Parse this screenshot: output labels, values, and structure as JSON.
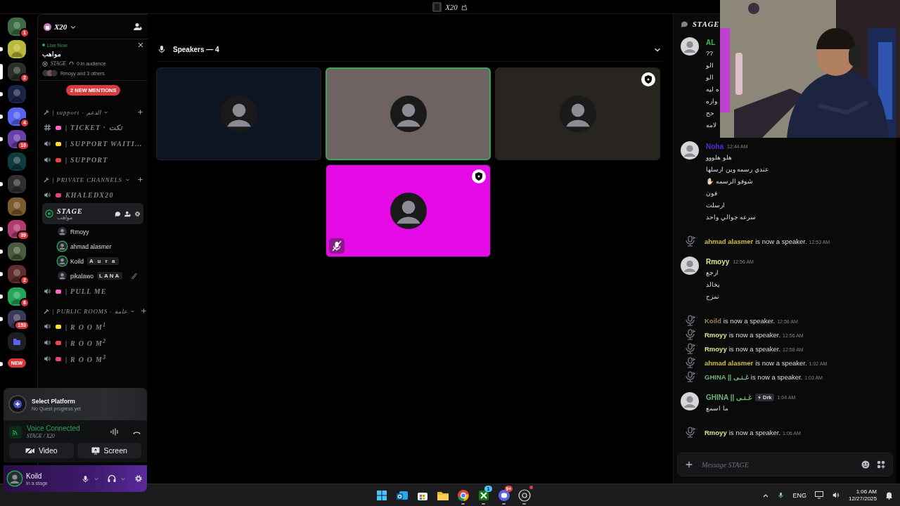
{
  "title_bar": {
    "title": "X20"
  },
  "servers": [
    {
      "kind": "server",
      "color": "#3e6b45",
      "badge": "1",
      "unread": false,
      "selected": false
    },
    {
      "kind": "server",
      "color": "#b9b838",
      "unread": true,
      "selected": false
    },
    {
      "kind": "server",
      "color": "#2b302c",
      "badge": "2",
      "unread": false,
      "selected": true
    },
    {
      "kind": "server",
      "color": "#1b2446",
      "unread": true,
      "selected": false
    },
    {
      "kind": "server",
      "color": "#5865f2",
      "badge": "4",
      "unread": true,
      "selected": false
    },
    {
      "kind": "server",
      "color": "#6a3fa8",
      "badge": "10",
      "unread": true,
      "selected": false
    },
    {
      "kind": "server",
      "color": "#0f3c40",
      "unread": false,
      "selected": false
    },
    {
      "kind": "server",
      "color": "#303030",
      "unread": true,
      "selected": false
    },
    {
      "kind": "server",
      "color": "#7d5a2e",
      "unread": false,
      "selected": false
    },
    {
      "kind": "server",
      "color": "#b23a6e",
      "badge": "39",
      "unread": true,
      "selected": false
    },
    {
      "kind": "server",
      "color": "#4b5a3c",
      "unread": true,
      "selected": false
    },
    {
      "kind": "server",
      "color": "#5e2d2d",
      "badge": "2",
      "unread": true,
      "selected": false
    },
    {
      "kind": "server",
      "color": "#23a55a",
      "badge": "6",
      "unread": true,
      "selected": false
    },
    {
      "kind": "server",
      "color": "#3a3a58",
      "badge": "153",
      "unread": true,
      "selected": false
    },
    {
      "kind": "folder",
      "color": "#1e1f22",
      "unread": false,
      "selected": false
    },
    {
      "kind": "new",
      "label": "NEW",
      "unread": true,
      "selected": false
    }
  ],
  "server": {
    "name": "X20",
    "live": {
      "label": "Live Now",
      "title": "مواهب",
      "channel": "STAGE",
      "audience": "0 in audience",
      "speakers": "Rmoyy and 3 others"
    },
    "mentions": "2 NEW MENTIONS"
  },
  "channels": [
    {
      "kind": "category",
      "name": "| support · الدعم"
    },
    {
      "kind": "text",
      "name": "| TICKET · تكت"
    },
    {
      "kind": "voice",
      "name": "| SUPPORT WAITI…"
    },
    {
      "kind": "voice",
      "name": "| SUPPORT"
    },
    {
      "kind": "category",
      "name": "| PRIVATE CHANNELS"
    },
    {
      "kind": "voice",
      "name": "KHALEDX20"
    },
    {
      "kind": "stage",
      "name": "STAGE",
      "topic": "مواهب",
      "selected": true,
      "members": [
        {
          "name": "Rmoyy",
          "speaking": false,
          "muted": false
        },
        {
          "name": "ahmad alasmer",
          "speaking": true,
          "muted": false
        },
        {
          "name": "Koild",
          "tag": "A u r a",
          "speaking": true,
          "muted": false
        },
        {
          "name": "pikalawo",
          "tag": "LANA",
          "speaking": false,
          "muted": true
        }
      ]
    },
    {
      "kind": "voice",
      "name": "| PULL ME"
    },
    {
      "kind": "category",
      "name": "| PUBLIC ROOMS · عامة"
    },
    {
      "kind": "voice",
      "name": "| R O O M$^{1}$"
    },
    {
      "kind": "voice",
      "name": "| R O O M$^{2}$"
    },
    {
      "kind": "voice",
      "name": "| R O O M$^{3}$"
    }
  ],
  "quest": {
    "title": "Select Platform",
    "subtitle": "No Quest progress yet"
  },
  "voice": {
    "status": "Voice Connected",
    "channel": "STAGE / X20",
    "buttons": [
      "Video",
      "Screen"
    ]
  },
  "user": {
    "name": "Koild",
    "status": "In a stage"
  },
  "stage": {
    "heading": "Speakers — 4",
    "tiles": [
      {
        "color": "#0d1422",
        "speaking": false,
        "moderator": false,
        "muted": false
      },
      {
        "color": "#6e6262",
        "speaking": true,
        "moderator": false,
        "muted": false
      },
      {
        "color": "#28241f",
        "speaking": false,
        "moderator": true,
        "muted": false
      },
      {
        "color": "#e60ae6",
        "speaking": false,
        "moderator": true,
        "muted": true
      }
    ]
  },
  "chat": {
    "channel": "STAGE",
    "placeholder": "Message STAGE",
    "messages": [
      {
        "kind": "message",
        "author": "AL",
        "color": "#43b85c",
        "lines": [
          "??",
          "الو",
          "الو",
          "ه ليه",
          "واره",
          "حح",
          "لامه"
        ]
      },
      {
        "kind": "message",
        "author": "Noha",
        "color": "#5a2ad8",
        "time": "12:44 AM",
        "lines": [
          "هلو هلووو",
          "عندي رسمه وين ارسلها",
          "شوفو الرسمه ✋🏻",
          "فون",
          "ارسلت",
          "سرعه جوالي واحد"
        ]
      },
      {
        "kind": "system",
        "user": "ahmad alasmer",
        "color": "#d6bd3c",
        "text": "is now a speaker.",
        "time": "12:53 AM"
      },
      {
        "kind": "message",
        "author": "Rmoyy",
        "color": "#dfe38a",
        "time": "12:56 AM",
        "lines": [
          "ارجع",
          "يخالد",
          "نمزح"
        ]
      },
      {
        "kind": "system",
        "user": "Koild",
        "color": "#9c8659",
        "text": "is now a speaker.",
        "time": "12:56 AM"
      },
      {
        "kind": "system",
        "user": "Rmoyy",
        "color": "#dfe38a",
        "text": "is now a speaker.",
        "time": "12:56 AM"
      },
      {
        "kind": "system",
        "user": "Rmoyy",
        "color": "#dfe38a",
        "text": "is now a speaker.",
        "time": "12:58 AM"
      },
      {
        "kind": "system",
        "user": "ahmad alasmer",
        "color": "#d6bd3c",
        "text": "is now a speaker.",
        "time": "1:02 AM"
      },
      {
        "kind": "system",
        "user": "GHINA || غـنـى",
        "color": "#6fb27a",
        "text": "is now a speaker.",
        "time": "1:03 AM"
      },
      {
        "kind": "message",
        "author": "GHINA || غـنـى",
        "color": "#6fb27a",
        "tag": "Drk",
        "time": "1:04 AM",
        "lines": [
          "ما اسمع"
        ]
      },
      {
        "kind": "system",
        "user": "Rmoyy",
        "color": "#dfe38a",
        "text": "is now a speaker.",
        "time": "1:06 AM"
      }
    ]
  },
  "taskbar": {
    "apps": [
      {
        "kind": "windows",
        "running": false
      },
      {
        "kind": "mail",
        "running": false
      },
      {
        "kind": "store",
        "running": false
      },
      {
        "kind": "folder",
        "running": false
      },
      {
        "kind": "browser",
        "running": true
      },
      {
        "kind": "xbox",
        "running": true,
        "badge": "1"
      },
      {
        "kind": "discord",
        "running": true,
        "badge": "9+"
      },
      {
        "kind": "recorder",
        "running": true,
        "alert": true
      }
    ],
    "language": "ENG",
    "time": "1:06 AM",
    "date": "12/27/2025"
  }
}
